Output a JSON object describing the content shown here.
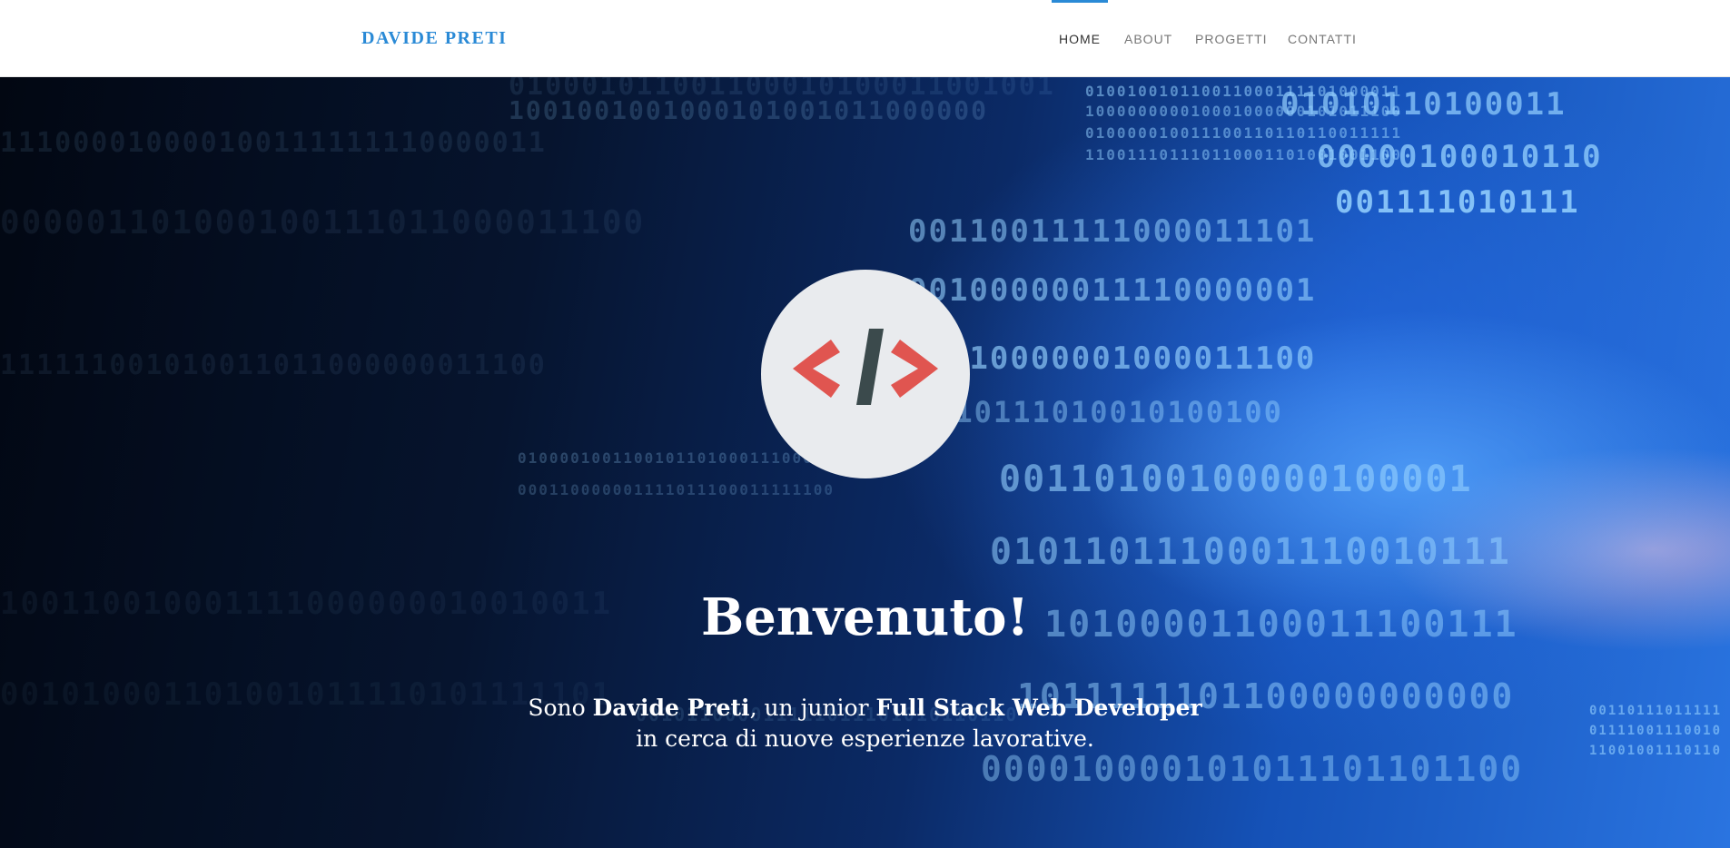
{
  "navbar": {
    "brand": "DAVIDE PRETI",
    "links": [
      {
        "label": "HOME",
        "active": true
      },
      {
        "label": "ABOUT",
        "active": false
      },
      {
        "label": "PROGETTI",
        "active": false
      },
      {
        "label": "CONTATTI",
        "active": false
      }
    ]
  },
  "hero": {
    "title": "Benvenuto!",
    "intro": {
      "part1": "Sono ",
      "name": "Davide Preti",
      "part2": ", un junior ",
      "role": "Full Stack Web Developer",
      "line2": "in cerca di nuove esperienze lavorative."
    },
    "logo_icon": "code-brackets-icon",
    "background": "binary-code-pattern"
  },
  "colors": {
    "accent": "#2a8ad6",
    "logo_brackets": "#e05550",
    "logo_slash": "#3b4a4c",
    "logo_circle": "#e9ebee"
  }
}
